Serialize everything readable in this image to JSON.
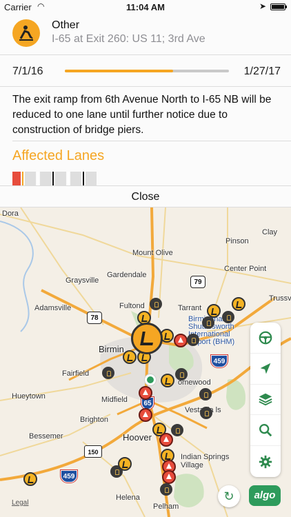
{
  "status_bar": {
    "carrier": "Carrier",
    "time": "11:04 AM"
  },
  "incident": {
    "type": "Other",
    "location": "I-65 at Exit 260: US 11; 3rd Ave",
    "start_date": "7/1/16",
    "end_date": "1/27/17",
    "progress": 0.66,
    "description": "The exit ramp from 6th Avenue North to I-65 NB will be reduced to one lane until further notice due to construction of bridge piers.",
    "affected_lanes_label": "Affected Lanes",
    "close_label": "Close"
  },
  "colors": {
    "accent": "#f5a623",
    "brand": "#2e9b5c",
    "closed_lane": "#e74c3c"
  },
  "map": {
    "places": {
      "dora": "Dora",
      "clay": "Clay",
      "mount_olive": "Mount Olive",
      "pinson": "Pinson",
      "gardendale": "Gardendale",
      "center_point": "Center Point",
      "graysville": "Graysville",
      "trussville": "Trussv",
      "adamsville": "Adamsville",
      "fultondale": "Fultond",
      "tarrant": "Tarrant",
      "birmingham_shuttlesworth": "Birmingham-\nShuttlesworth\nInternational\nAirport (BHM)",
      "birmingham": "Birmin",
      "fairfield": "Fairfield",
      "homewood": "omewood",
      "hueytown": "Hueytown",
      "midfield": "Midfield",
      "brighton": "Brighton",
      "vestavia": "Vestavia   ls",
      "bessemer": "Bessemer",
      "hoover": "Hoover",
      "indian_springs": "Indian Springs\nVillage",
      "helena": "Helena",
      "pelham": "Pelham"
    },
    "shields": {
      "s79": "79",
      "us78": "78",
      "i459a": "459",
      "i65": "65",
      "s150": "150",
      "i459b": "459"
    },
    "legal": "Legal"
  },
  "toolbar": {
    "steering_icon": "steering-wheel-icon",
    "navigate_icon": "navigation-arrow-icon",
    "layers_icon": "layers-icon",
    "search_icon": "search-icon",
    "settings_icon": "gear-icon",
    "refresh_icon": "refresh-icon",
    "brand_label": "algo"
  }
}
